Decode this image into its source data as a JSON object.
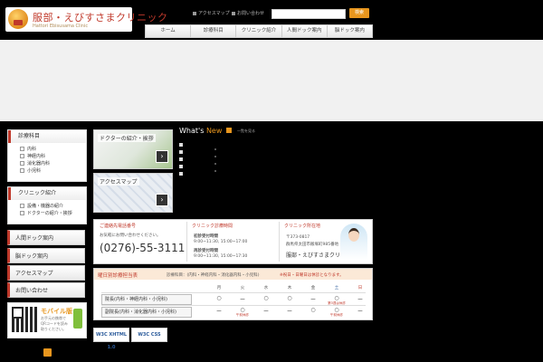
{
  "header": {
    "logo_title": "服部・えびすさまクリニック",
    "logo_sub": "Hattori Ebisusama Clinic",
    "links": [
      "アクセスマップ",
      "お問い合わせ"
    ],
    "search_button": "検索"
  },
  "nav": [
    "ホーム",
    "診療科目",
    "クリニック紹介",
    "人間ドック案内",
    "脳ドック案内"
  ],
  "sidebar": {
    "section1_title": "診療科目",
    "section1_items": [
      "内科",
      "神経内科",
      "消化器内科",
      "小児科"
    ],
    "section2_title": "クリニック紹介",
    "section2_items": [
      "設備・機器の紹介",
      "ドクターの紹介・挨拶"
    ],
    "buttons": [
      "人間ドック案内",
      "脳ドック案内",
      "アクセスマップ",
      "お問い合わせ"
    ],
    "mobile_label": "モバイル版",
    "mobile_desc": "お手元の携帯でQRコードを読み取りください。"
  },
  "thumbs": [
    "ドクターの紹介・挨拶",
    "アクセスマップ"
  ],
  "whats_new": {
    "title_a": "What's ",
    "title_b": "New",
    "list_button": "一覧を見る"
  },
  "contact": {
    "phone_head": "ご連絡先電話番号",
    "phone_sub": "お気軽にお問い合わせください。",
    "phone": "(0276)-55-3111",
    "hours_head": "クリニック診療時間",
    "first_label": "初診受付時間",
    "first_hours": "9:00~11:30, 15:00~17:00",
    "return_label": "再診受付時間",
    "return_hours": "9:00~11:30, 15:00~17:30",
    "addr_head": "クリニック所在地",
    "zip": "〒373-0817",
    "address": "群馬県太田市飯塚町985番地",
    "name": "服部・えびすさまクリニック"
  },
  "schedule": {
    "title": "曜日別診療担当表",
    "note1": "診療科目：(内科・神経内科・消化器内科・小児科)",
    "note2": "※祝日・日曜日は休診となります。",
    "days": [
      "月",
      "火",
      "水",
      "木",
      "金",
      "土",
      "日"
    ],
    "rows": [
      {
        "label": "院長(内科・神経内科・小児科)",
        "cells": [
          "○",
          "ー",
          "○",
          "○",
          "ー",
          "○",
          "ー"
        ],
        "notes": [
          "",
          "",
          "",
          "",
          "",
          "第3週は休診",
          ""
        ]
      },
      {
        "label": "副院長(内科・消化器内科・小児科)",
        "cells": [
          "ー",
          "○",
          "ー",
          "ー",
          "○",
          "○",
          "ー"
        ],
        "notes": [
          "",
          "午前休診",
          "",
          "",
          "",
          "午前休診",
          ""
        ]
      }
    ]
  },
  "badges": [
    "W3C XHTML 1.0",
    "W3C CSS"
  ]
}
